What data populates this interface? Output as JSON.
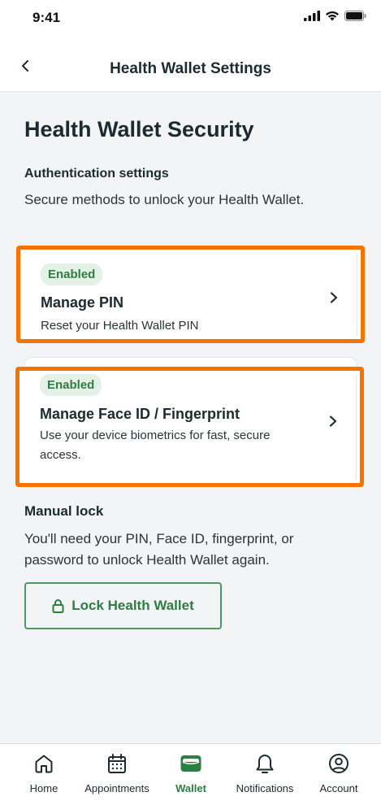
{
  "status_bar": {
    "time": "9:41"
  },
  "header": {
    "title": "Health Wallet Settings"
  },
  "page": {
    "title": "Health Wallet Security",
    "auth_heading": "Authentication settings",
    "auth_description": "Secure methods to unlock your Health Wallet."
  },
  "cards": [
    {
      "badge": "Enabled",
      "title": "Manage PIN",
      "subtitle": "Reset your Health Wallet PIN"
    },
    {
      "badge": "Enabled",
      "title": "Manage Face ID / Fingerprint",
      "subtitle": "Use your device biometrics for fast, secure access."
    }
  ],
  "manual_lock": {
    "heading": "Manual lock",
    "description": "You'll need your PIN, Face ID, fingerprint, or password to unlock Health Wallet again.",
    "button_label": "Lock Health Wallet"
  },
  "tabs": [
    {
      "label": "Home",
      "icon": "home-icon"
    },
    {
      "label": "Appointments",
      "icon": "calendar-icon"
    },
    {
      "label": "Wallet",
      "icon": "wallet-icon",
      "active": true
    },
    {
      "label": "Notifications",
      "icon": "bell-icon"
    },
    {
      "label": "Account",
      "icon": "account-icon"
    }
  ],
  "colors": {
    "accent_green": "#2e7d43",
    "highlight_orange": "#f57300",
    "badge_bg": "#e3f1e6"
  }
}
